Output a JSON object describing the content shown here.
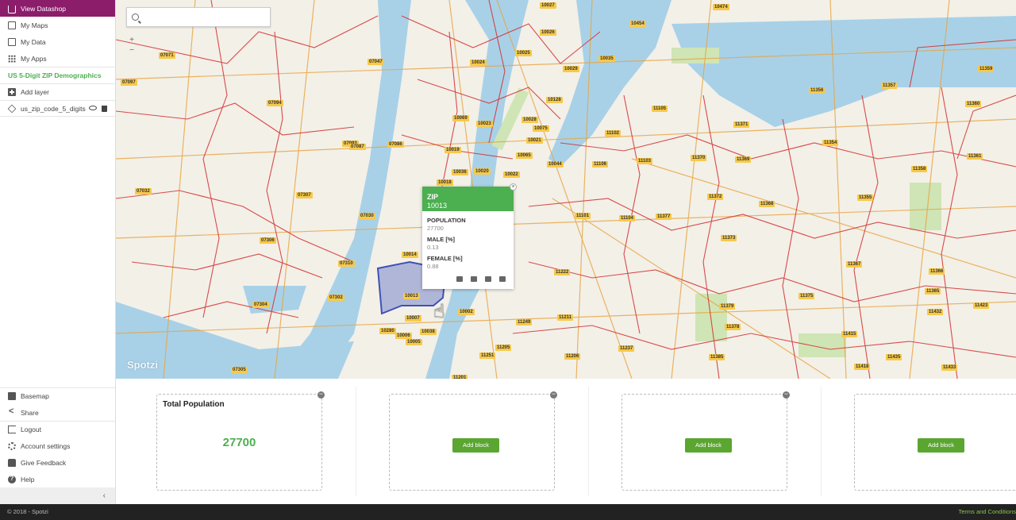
{
  "sidebar": {
    "top_items": [
      {
        "label": "View Datashop",
        "icon": "cart-icon"
      },
      {
        "label": "My Maps",
        "icon": "maps-icon"
      },
      {
        "label": "My Data",
        "icon": "data-icon"
      },
      {
        "label": "My Apps",
        "icon": "apps-icon"
      }
    ],
    "section_title": "US 5-Digit ZIP Demographics",
    "add_layer": "Add layer",
    "layer_name": "us_zip_code_5_digits",
    "bottom_items": [
      {
        "label": "Basemap",
        "icon": "basemap-icon"
      },
      {
        "label": "Share",
        "icon": "share-icon"
      },
      {
        "label": "Logout",
        "icon": "logout-icon"
      },
      {
        "label": "Account settings",
        "icon": "gear-icon"
      },
      {
        "label": "Give Feedback",
        "icon": "thumb-icon"
      },
      {
        "label": "Help",
        "icon": "help-icon"
      }
    ],
    "collapse_glyph": "‹"
  },
  "map": {
    "search_placeholder": "",
    "zoom_in": "+",
    "zoom_out": "−",
    "watermark": "Spotzi",
    "zip_labels": [
      "10027",
      "10474",
      "10454",
      "10026",
      "10029",
      "10025",
      "10035",
      "10024",
      "10128",
      "10069",
      "10023",
      "10028",
      "10075",
      "10065",
      "10021",
      "10019",
      "10036",
      "10020",
      "10022",
      "10044",
      "10018",
      "10014",
      "10013",
      "10002",
      "10007",
      "10038",
      "10006",
      "10005",
      "10280",
      "11249",
      "11211",
      "11222",
      "11101",
      "11104",
      "11377",
      "11373",
      "11106",
      "11103",
      "11105",
      "11102",
      "11370",
      "11369",
      "11372",
      "11368",
      "11371",
      "11355",
      "11354",
      "11356",
      "11357",
      "11360",
      "11361",
      "11358",
      "11359",
      "11367",
      "11366",
      "11375",
      "11379",
      "11378",
      "11385",
      "11237",
      "11206",
      "11205",
      "11201",
      "11251",
      "11415",
      "11435",
      "11418",
      "11432",
      "11423",
      "11433",
      "11365",
      "07071",
      "07047",
      "07094",
      "07093",
      "07087",
      "07086",
      "07032",
      "07307",
      "07030",
      "07306",
      "07310",
      "07302",
      "07304",
      "07305",
      "07097"
    ],
    "colors": {
      "zip_fill": "#f7c948",
      "boundary": "#d32f2f",
      "selected": "#3f51b5",
      "accent": "#4caf50"
    }
  },
  "popup": {
    "header_label": "ZIP",
    "header_value": "10013",
    "fields": [
      {
        "label": "POPULATION",
        "value": "27700"
      },
      {
        "label": "MALE [%]",
        "value": "0.13"
      },
      {
        "label": "FEMALE [%]",
        "value": "0.88"
      }
    ],
    "close_glyph": "×",
    "actions": [
      "table-icon",
      "edit-icon",
      "map-icon",
      "trash-icon"
    ]
  },
  "dashboard": {
    "blocks": [
      {
        "title": "Total Population",
        "value": "27700"
      },
      {
        "button": "Add block"
      },
      {
        "button": "Add block"
      },
      {
        "button": "Add block"
      }
    ],
    "remove_glyph": "−"
  },
  "footer": {
    "copyright": "© 2018 - Spotzi",
    "terms": "Terms and Conditions"
  }
}
